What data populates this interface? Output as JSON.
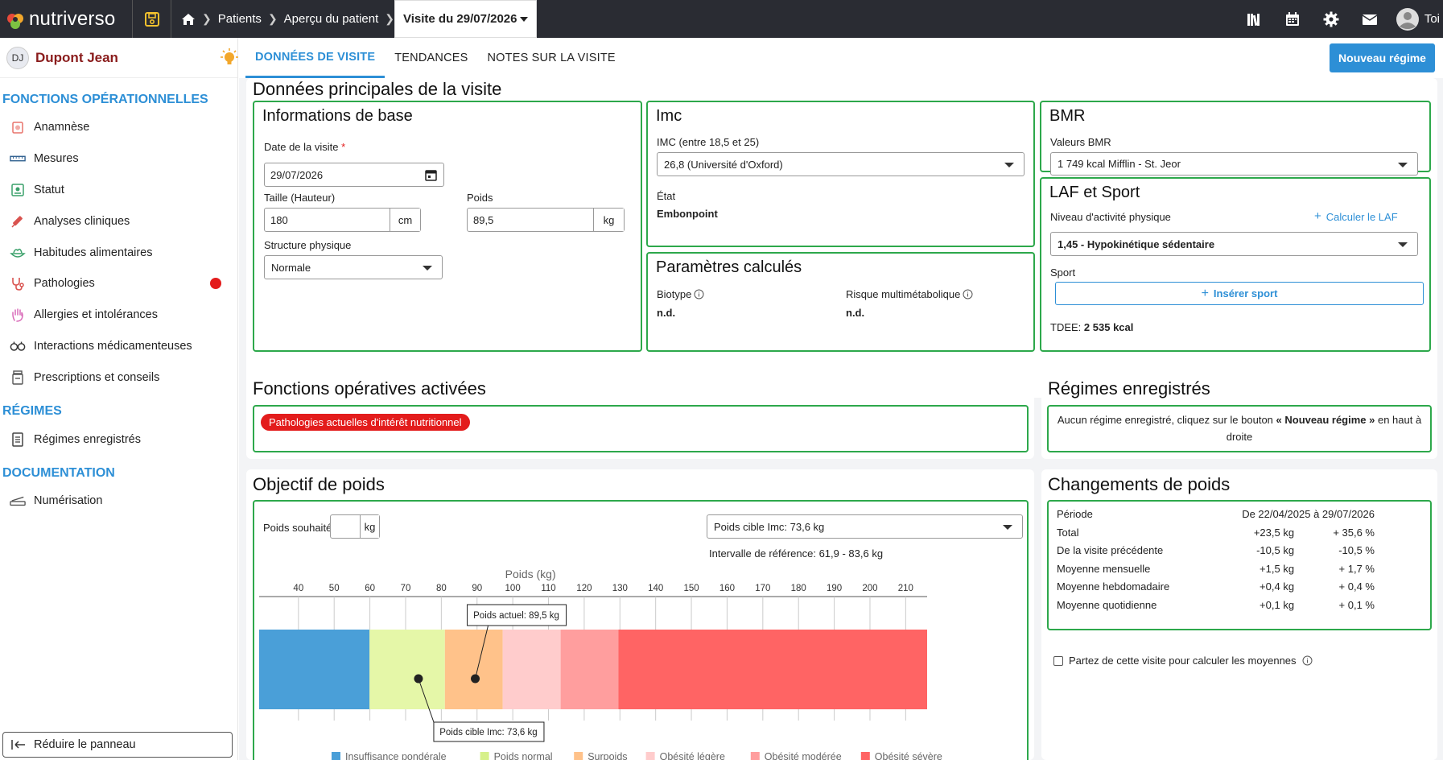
{
  "app": {
    "logo_text": "nutriverso"
  },
  "breadcrumb": {
    "items": [
      "Patients",
      "Aperçu du patient"
    ],
    "current": "Visite du 29/07/2026"
  },
  "user": {
    "name": "Toi"
  },
  "patient": {
    "initials": "DJ",
    "name": "Dupont Jean"
  },
  "sidebar": {
    "sections": [
      {
        "title": "FONCTIONS OPÉRATIONNELLES",
        "items": [
          {
            "label": "Anamnèse",
            "icon": "clipboard-icon",
            "color": "#e8736b"
          },
          {
            "label": "Mesures",
            "icon": "ruler-icon",
            "color": "#2d5e8e"
          },
          {
            "label": "Statut",
            "icon": "status-icon",
            "color": "#3aa06a"
          },
          {
            "label": "Analyses cliniques",
            "icon": "syringe-icon",
            "color": "#d9534f"
          },
          {
            "label": "Habitudes alimentaires",
            "icon": "food-icon",
            "color": "#3aa06a"
          },
          {
            "label": "Pathologies",
            "icon": "stethoscope-icon",
            "color": "#d9534f",
            "alert": true
          },
          {
            "label": "Allergies et intolérances",
            "icon": "hand-icon",
            "color": "#d96ab8"
          },
          {
            "label": "Interactions médicamenteuses",
            "icon": "interaction-icon",
            "color": "#333"
          },
          {
            "label": "Prescriptions et conseils",
            "icon": "pill-bottle-icon",
            "color": "#555"
          }
        ]
      },
      {
        "title": "RÉGIMES",
        "items": [
          {
            "label": "Régimes enregistrés",
            "icon": "document-icon",
            "color": "#444"
          }
        ]
      },
      {
        "title": "DOCUMENTATION",
        "items": [
          {
            "label": "Numérisation",
            "icon": "scanner-icon",
            "color": "#555"
          }
        ]
      }
    ],
    "collapse_label": "Réduire le panneau"
  },
  "tabs": [
    "DONNÉES DE VISITE",
    "TENDANCES",
    "NOTES SUR LA VISITE"
  ],
  "new_regime_label": "Nouveau régime",
  "main_data": {
    "title": "Données principales de la visite",
    "base_info": {
      "title": "Informations de base",
      "date_label": "Date de la visite",
      "date_required": "*",
      "date_value": "29/07/2026",
      "height_label": "Taille (Hauteur)",
      "height_value": "180",
      "height_unit": "cm",
      "weight_label": "Poids",
      "weight_value": "89,5",
      "weight_unit": "kg",
      "structure_label": "Structure physique",
      "structure_value": "Normale"
    },
    "imc": {
      "title": "Imc",
      "range_label": "IMC (entre 18,5 et 25)",
      "value": "26,8 (Université d'Oxford)",
      "state_label": "État",
      "state_value": "Embonpoint"
    },
    "bmr": {
      "title": "BMR",
      "values_label": "Valeurs BMR",
      "value": "1 749 kcal Mifflin - St. Jeor"
    },
    "laf": {
      "title": "LAF et Sport",
      "activity_label": "Niveau d'activité physique",
      "calc_label": "Calculer le LAF",
      "activity_value": "1,45 - Hypokinétique sédentaire",
      "sport_label": "Sport",
      "insert_sport_label": "Insérer sport",
      "tdee_label": "TDEE:",
      "tdee_value": "2 535 kcal"
    },
    "calc_params": {
      "title": "Paramètres calculés",
      "biotype_label": "Biotype",
      "biotype_value": "n.d.",
      "risk_label": "Risque multimétabolique",
      "risk_value": "n.d."
    }
  },
  "ops": {
    "title": "Fonctions opératives activées",
    "badge": "Pathologies actuelles d'intérêt nutritionnel"
  },
  "regimes": {
    "title": "Régimes enregistrés",
    "message_pre": "Aucun régime enregistré, cliquez sur le bouton ",
    "message_bold": "« Nouveau régime »",
    "message_post": " en haut à droite"
  },
  "weight_goal": {
    "title": "Objectif de poids",
    "desired_label": "Poids souhaité",
    "desired_value": "",
    "desired_unit": "kg",
    "target_select": "Poids cible Imc: 73,6 kg",
    "ref_interval": "Intervalle de référence: 61,9 - 83,6 kg"
  },
  "chart_data": {
    "type": "bar",
    "xlabel": "Poids (kg)",
    "xlim": [
      29,
      216
    ],
    "ticks": [
      40,
      50,
      60,
      70,
      80,
      90,
      100,
      110,
      120,
      130,
      140,
      150,
      160,
      170,
      180,
      190,
      200,
      210
    ],
    "bands": [
      {
        "name": "Insuffisance pondérale",
        "from": 29,
        "to": 59.9,
        "color": "#4a9fd8"
      },
      {
        "name": "Poids normal",
        "from": 59.9,
        "to": 81,
        "color": "#e5f7a8"
      },
      {
        "name": "Surpoids",
        "from": 81,
        "to": 97.2,
        "color": "#ffc28a"
      },
      {
        "name": "Obésité légère",
        "from": 97.2,
        "to": 113.4,
        "color": "#ffcccc"
      },
      {
        "name": "Obésité modérée",
        "from": 113.4,
        "to": 129.6,
        "color": "#ff9e9e"
      },
      {
        "name": "Obésité sévère",
        "from": 129.6,
        "to": 216,
        "color": "#ff6464"
      }
    ],
    "markers": [
      {
        "label": "Poids actuel: 89,5 kg",
        "value": 89.5
      },
      {
        "label": "Poids cible Imc: 73,6 kg",
        "value": 73.6
      }
    ]
  },
  "weight_changes": {
    "title": "Changements de poids",
    "rows": [
      {
        "label": "Période",
        "abs": "",
        "pct": "De 22/04/2025 à 29/07/2026"
      },
      {
        "label": "Total",
        "abs": "+23,5 kg",
        "pct": "+ 35,6 %"
      },
      {
        "label": "De la visite précédente",
        "abs": "-10,5 kg",
        "pct": "-10,5 %"
      },
      {
        "label": "Moyenne mensuelle",
        "abs": "+1,5 kg",
        "pct": "+ 1,7 %"
      },
      {
        "label": "Moyenne hebdomadaire",
        "abs": "+0,4 kg",
        "pct": "+ 0,4 %"
      },
      {
        "label": "Moyenne quotidienne",
        "abs": "+0,1 kg",
        "pct": "+ 0,1 %"
      }
    ],
    "checkbox_label": "Partez de cette visite pour calculer les moyennes"
  }
}
